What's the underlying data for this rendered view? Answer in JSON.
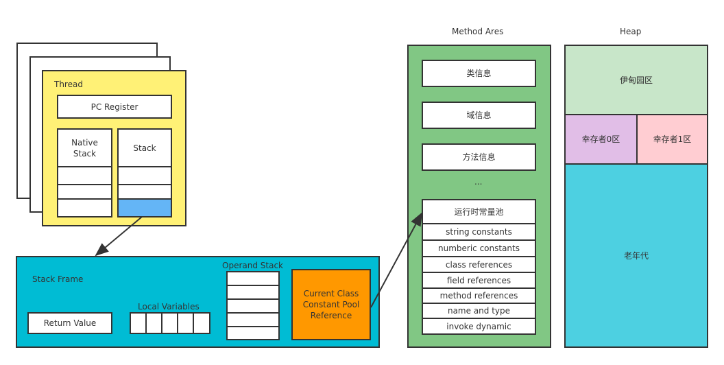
{
  "colors": {
    "thread": "#fff176",
    "current_frame": "#64b5f6",
    "stack_frame": "#00bcd4",
    "constant_pool_ref": "#ff9800",
    "method_area": "#81c784",
    "eden": "#c8e6c9",
    "survivor0": "#e1bee7",
    "survivor1": "#ffcdd2",
    "old_gen": "#4dd0e1"
  },
  "thread": {
    "label": "Thread",
    "pc_register": "PC Register",
    "native_stack": "Native Stack",
    "stack": "Stack"
  },
  "stack_frame": {
    "label": "Stack Frame",
    "return_value": "Return Value",
    "local_variables": "Local Variables",
    "operand_stack": "Operand Stack",
    "constant_pool_ref": "Current Class Constant Pool Reference"
  },
  "method_area": {
    "title": "Method Ares",
    "items": [
      "类信息",
      "域信息",
      "方法信息"
    ],
    "ellipsis": "...",
    "runtime_pool": "运行时常量池",
    "pool_entries": [
      "string constants",
      "numberic constants",
      "class references",
      "field references",
      "method references",
      "name and type",
      "invoke dynamic"
    ]
  },
  "heap": {
    "title": "Heap",
    "eden": "伊甸园区",
    "survivor0": "幸存者0区",
    "survivor1": "幸存者1区",
    "old": "老年代"
  }
}
